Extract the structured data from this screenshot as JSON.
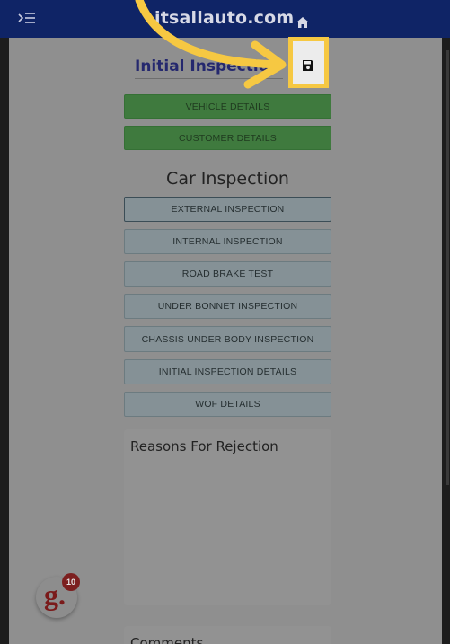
{
  "header": {
    "site_title": "itsallauto.com",
    "menu_icon": "menu-collapse-icon",
    "home_icon": "home-icon",
    "background_color": "#0f2466"
  },
  "page": {
    "heading": "Initial Inspection",
    "save_icon": "floppy-disk-icon",
    "highlight_color": "#f6c842"
  },
  "details_buttons": [
    {
      "label": "VEHICLE DETAILS"
    },
    {
      "label": "CUSTOMER DETAILS"
    }
  ],
  "car_inspection": {
    "title": "Car Inspection",
    "buttons": [
      {
        "label": "EXTERNAL INSPECTION"
      },
      {
        "label": "INTERNAL INSPECTION"
      },
      {
        "label": "ROAD BRAKE TEST"
      },
      {
        "label": "UNDER BONNET INSPECTION"
      },
      {
        "label": "CHASSIS UNDER BODY INSPECTION"
      },
      {
        "label": "INITIAL INSPECTION DETAILS"
      },
      {
        "label": "WOF DETAILS"
      }
    ]
  },
  "reasons_panel": {
    "label": "Reasons For Rejection"
  },
  "comments_panel": {
    "label": "Comments"
  },
  "badge": {
    "letter": "g.",
    "count": "10"
  }
}
